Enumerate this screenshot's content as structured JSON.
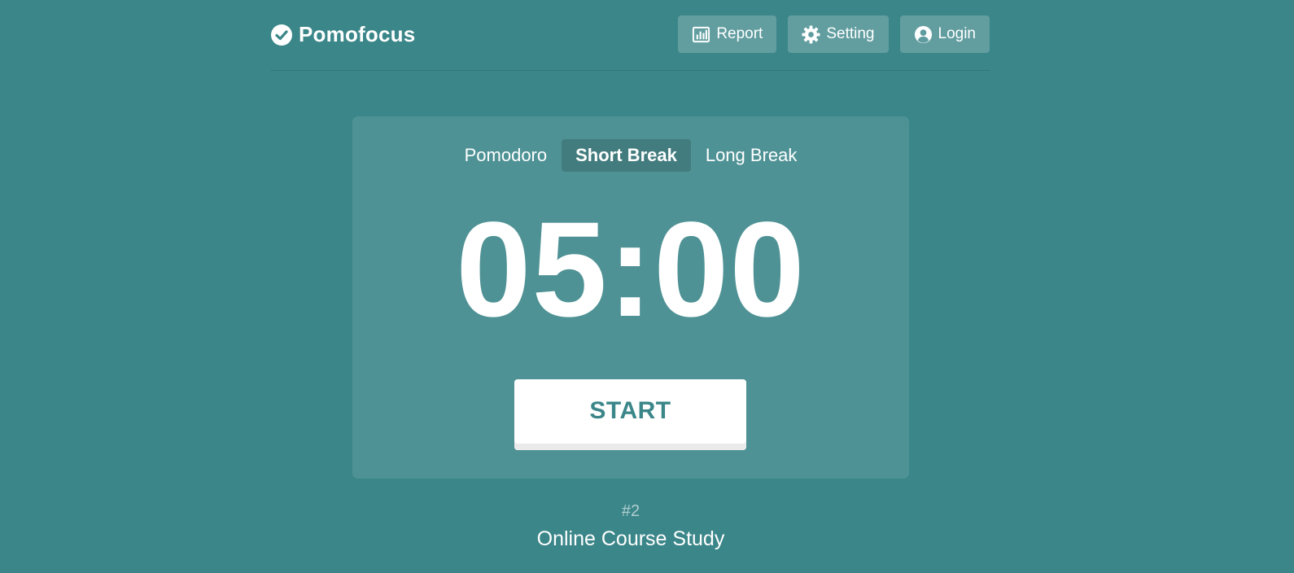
{
  "app": {
    "name": "Pomofocus",
    "logo_icon": "check-circle-icon"
  },
  "nav": {
    "report": {
      "label": "Report",
      "icon": "bar-chart-icon"
    },
    "setting": {
      "label": "Setting",
      "icon": "gear-icon"
    },
    "login": {
      "label": "Login",
      "icon": "user-circle-icon"
    }
  },
  "tabs": [
    {
      "label": "Pomodoro",
      "active": false
    },
    {
      "label": "Short Break",
      "active": true
    },
    {
      "label": "Long Break",
      "active": false
    }
  ],
  "timer": {
    "display": "05:00"
  },
  "controls": {
    "start_label": "START"
  },
  "session": {
    "count": "#2",
    "task": "Online Course Study"
  },
  "colors": {
    "background": "#3b8689",
    "accent_text": "#3b8689",
    "button_bg": "#ffffff"
  }
}
